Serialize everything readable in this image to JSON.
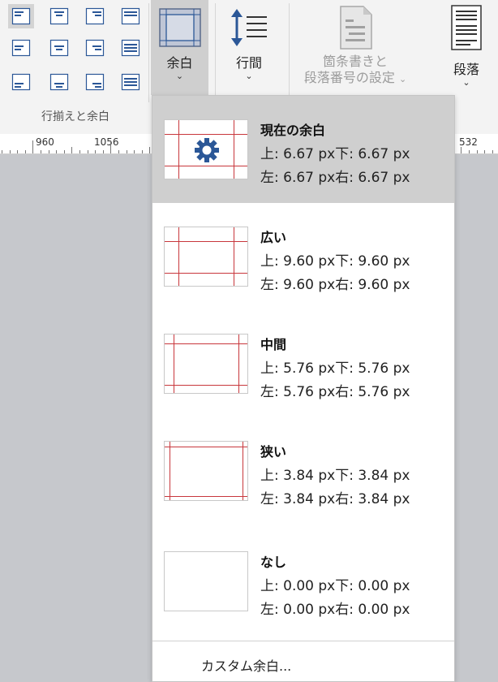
{
  "ribbon": {
    "alignment_group_label": "行揃えと余白",
    "margin_button": {
      "label": "余白",
      "chevron": "⌄"
    },
    "line_spacing_button": {
      "label": "行間",
      "chevron": "⌄"
    },
    "bullets_button": {
      "line1": "箇条書きと",
      "line2": "段落番号の設定",
      "chevron": "⌄"
    },
    "paragraph_button": {
      "label": "段落",
      "chevron": "⌄"
    }
  },
  "ruler": {
    "labels": [
      "960",
      "1056",
      "532"
    ]
  },
  "margin_dropdown": {
    "options": [
      {
        "title": "現在の余白",
        "line1": "上: 6.67 px下: 6.67 px",
        "line2": "左: 6.67 px右: 6.67 px",
        "icon": "gear-icon",
        "state": "current"
      },
      {
        "title": "広い",
        "line1": "上: 9.60 px下: 9.60 px",
        "line2": "左: 9.60 px右: 9.60 px"
      },
      {
        "title": "中間",
        "line1": "上: 5.76 px下: 5.76 px",
        "line2": "左: 5.76 px右: 5.76 px"
      },
      {
        "title": "狭い",
        "line1": "上: 3.84 px下: 3.84 px",
        "line2": "左: 3.84 px右: 3.84 px"
      },
      {
        "title": "なし",
        "line1": "上: 0.00 px下: 0.00 px",
        "line2": "左: 0.00 px右: 0.00 px"
      }
    ],
    "custom_label": "カスタム余白..."
  },
  "colors": {
    "margin_line": "#c8373c",
    "icon_blue": "#2b5797"
  }
}
